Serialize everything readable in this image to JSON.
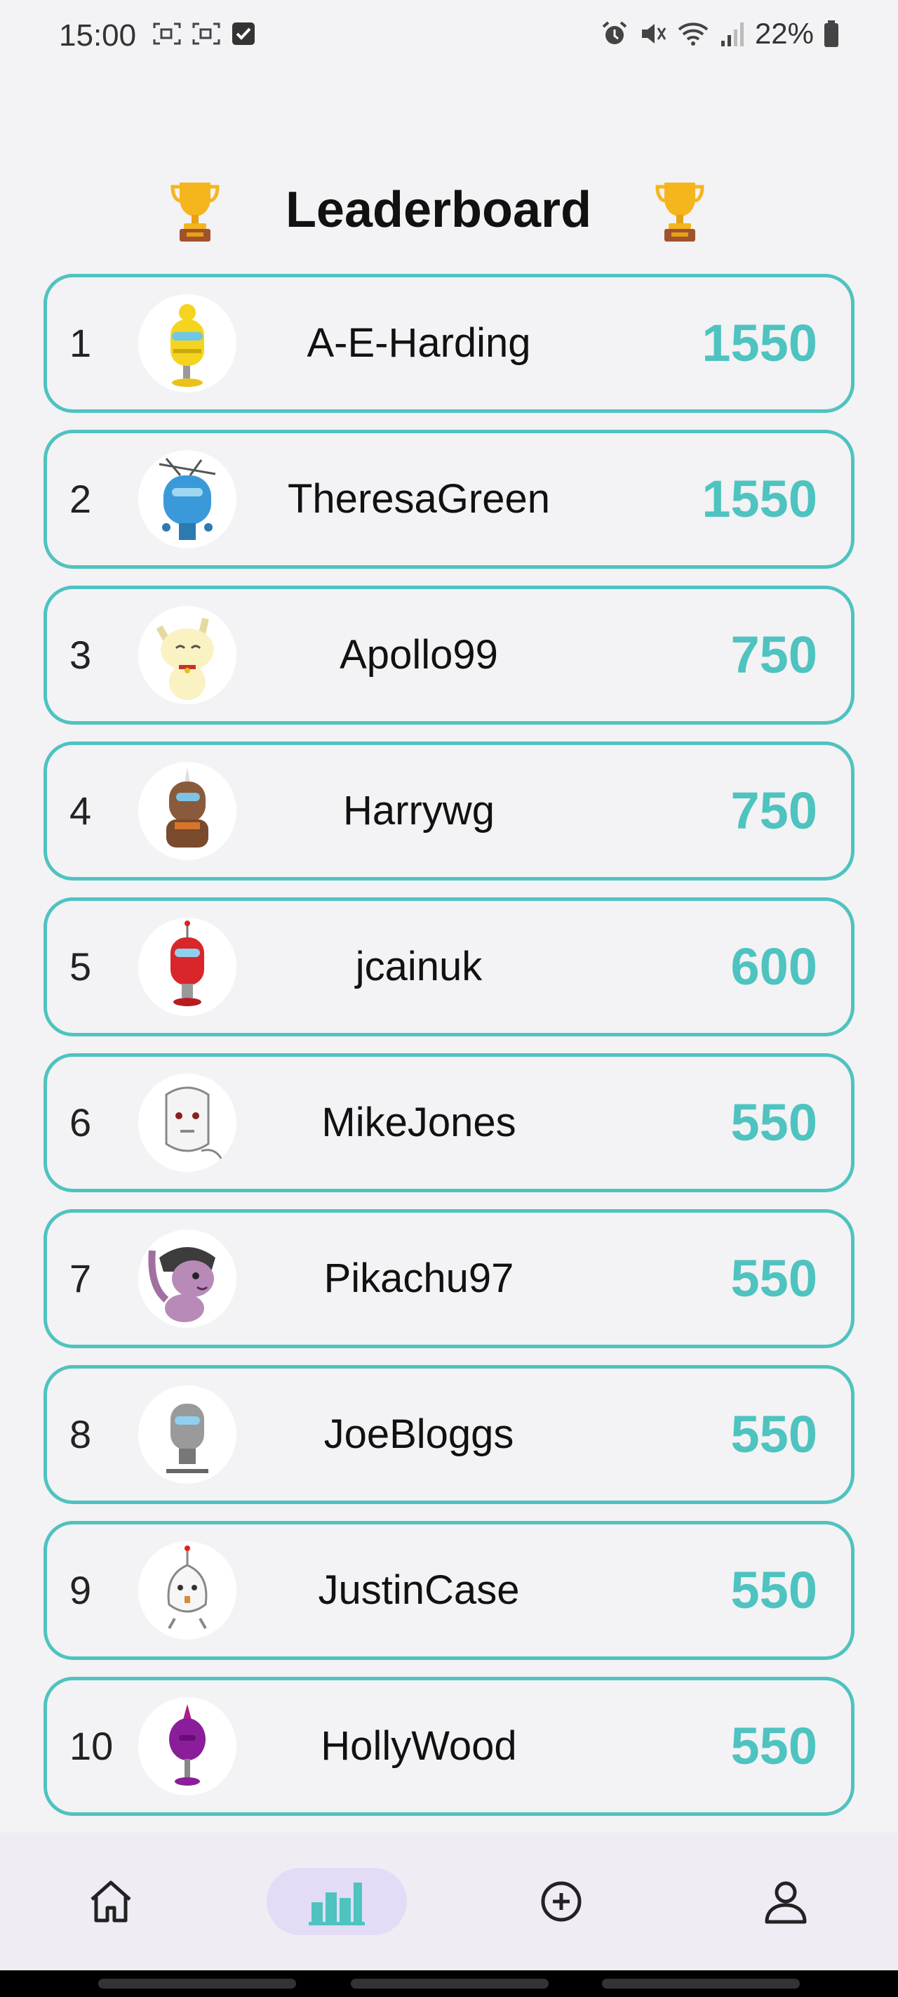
{
  "status": {
    "time": "15:00",
    "battery": "22%"
  },
  "header": {
    "title": "Leaderboard",
    "trophy_icon": "trophy-icon"
  },
  "leaderboard": [
    {
      "rank": "1",
      "name": "A-E-Harding",
      "score": "1550",
      "avatar": "yellow-robot"
    },
    {
      "rank": "2",
      "name": "TheresaGreen",
      "score": "1550",
      "avatar": "blue-robot-antenna"
    },
    {
      "rank": "3",
      "name": "Apollo99",
      "score": "750",
      "avatar": "cream-cat"
    },
    {
      "rank": "4",
      "name": "Harrywg",
      "score": "750",
      "avatar": "brown-robot"
    },
    {
      "rank": "5",
      "name": "jcainuk",
      "score": "600",
      "avatar": "red-robot"
    },
    {
      "rank": "6",
      "name": "MikeJones",
      "score": "550",
      "avatar": "white-mask"
    },
    {
      "rank": "7",
      "name": "Pikachu97",
      "score": "550",
      "avatar": "purple-pony"
    },
    {
      "rank": "8",
      "name": "JoeBloggs",
      "score": "550",
      "avatar": "grey-robot"
    },
    {
      "rank": "9",
      "name": "JustinCase",
      "score": "550",
      "avatar": "white-robot"
    },
    {
      "rank": "10",
      "name": "HollyWood",
      "score": "550",
      "avatar": "purple-robot"
    }
  ],
  "nav": [
    {
      "icon": "home-icon",
      "active": false
    },
    {
      "icon": "leaderboard-icon",
      "active": true
    },
    {
      "icon": "add-circle-icon",
      "active": false
    },
    {
      "icon": "profile-icon",
      "active": false
    }
  ],
  "colors": {
    "accent": "#4ec3c0",
    "background": "#f3f2f4",
    "nav_active": "#e4dcf6"
  }
}
